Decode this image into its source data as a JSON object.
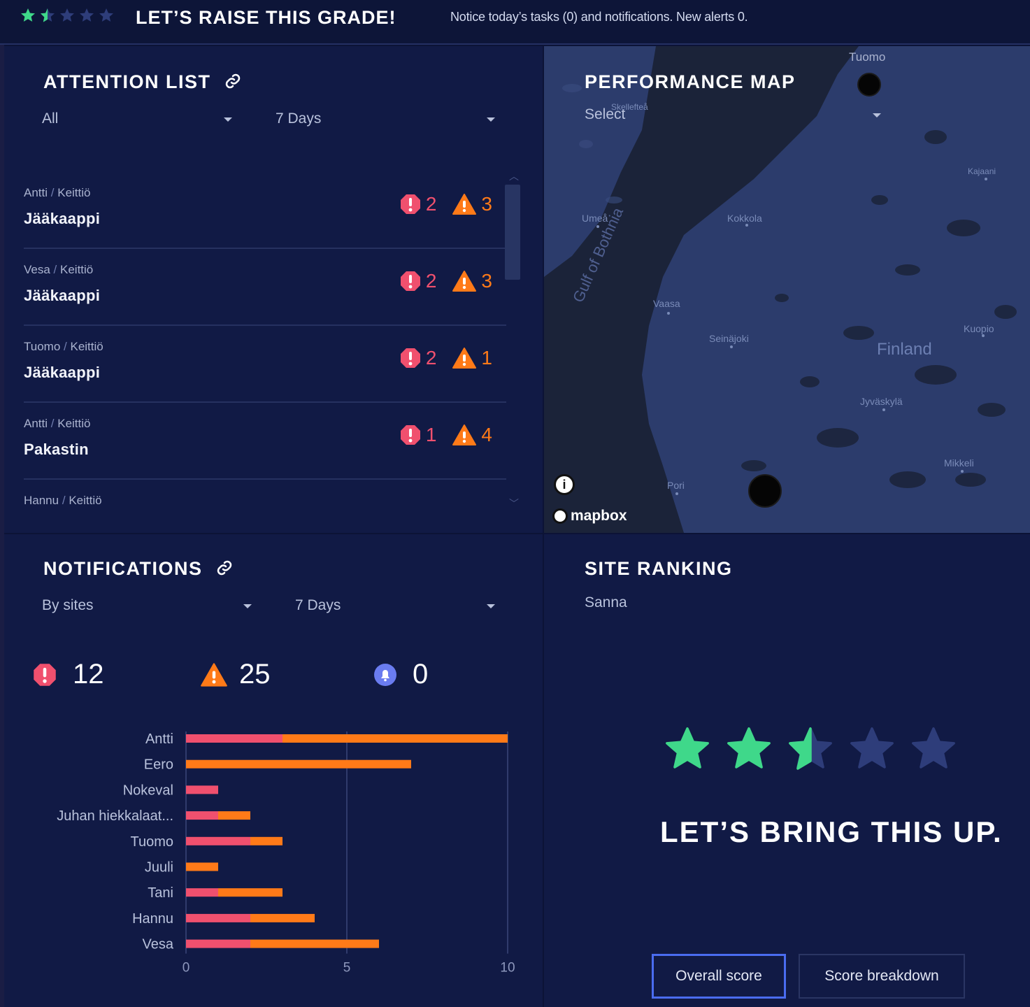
{
  "colors": {
    "critical": "#f0506e",
    "warning": "#ff7a18",
    "info": "#6a7cf0",
    "star_filled": "#3fd88a",
    "star_empty": "#2e3d7a"
  },
  "header": {
    "rating_stars": 1.5,
    "title": "LET’S RAISE THIS GRADE!",
    "notice": "Notice today’s tasks (0) and notifications. New alerts 0."
  },
  "attention": {
    "title": "ATTENTION LIST",
    "filter": "All",
    "period": "7 Days",
    "items": [
      {
        "person": "Antti",
        "room": "Keittiö",
        "device": "Jääkaappi",
        "critical": "2",
        "warning": "3"
      },
      {
        "person": "Vesa",
        "room": "Keittiö",
        "device": "Jääkaappi",
        "critical": "2",
        "warning": "3"
      },
      {
        "person": "Tuomo",
        "room": "Keittiö",
        "device": "Jääkaappi",
        "critical": "2",
        "warning": "1"
      },
      {
        "person": "Antti",
        "room": "Keittiö",
        "device": "Pakastin",
        "critical": "1",
        "warning": "4"
      },
      {
        "person": "Hannu",
        "room": "Keittiö",
        "device": "",
        "critical": "",
        "warning": ""
      }
    ]
  },
  "map": {
    "title": "PERFORMANCE MAP",
    "select_placeholder": "Select",
    "labels": {
      "tuomo": "Tuomo",
      "skelleftea": "Skellefteå",
      "umea": "Umeå",
      "kokkola": "Kokkola",
      "gulf": "Gulf of Bothnia",
      "vaasa": "Vaasa",
      "seinajoki": "Seinäjoki",
      "finland": "Finland",
      "kajaani": "Kajaani",
      "kuopio": "Kuopio",
      "jyvaskyla": "Jyväskylä",
      "mikkeli": "Mikkeli",
      "pori": "Pori"
    },
    "attribution": "mapbox",
    "info_icon": "i"
  },
  "notifications": {
    "title": "NOTIFICATIONS",
    "filter": "By sites",
    "period": "7 Days",
    "critical_count": "12",
    "warning_count": "25",
    "info_count": "0"
  },
  "chart_data": {
    "type": "bar",
    "orientation": "horizontal",
    "stacked": true,
    "categories": [
      "Antti",
      "Eero",
      "Nokeval",
      "Juhan hiekkalaat...",
      "Tuomo",
      "Juuli",
      "Tani",
      "Hannu",
      "Vesa"
    ],
    "series": [
      {
        "color": "#f0506e",
        "values": [
          3,
          0,
          1,
          1,
          2,
          0,
          1,
          2,
          2
        ]
      },
      {
        "color": "#ff7a18",
        "values": [
          7,
          7,
          0,
          1,
          1,
          1,
          2,
          2,
          4
        ]
      }
    ],
    "xlim": [
      0,
      10
    ],
    "xticks": [
      "0",
      "5",
      "10"
    ],
    "grid": true
  },
  "ranking": {
    "title": "SITE RANKING",
    "site": "Sanna",
    "stars": 2.5,
    "message": "LET’S BRING THIS UP.",
    "buttons": {
      "overall": "Overall score",
      "breakdown": "Score breakdown"
    }
  }
}
